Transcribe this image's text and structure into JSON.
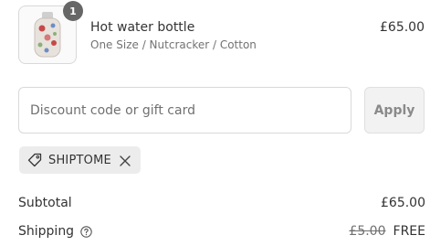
{
  "line_item": {
    "quantity": "1",
    "title": "Hot water bottle",
    "variant": "One Size / Nutcracker / Cotton",
    "price": "£65.00",
    "image_icon": "hot-water-bottle-icon"
  },
  "discount": {
    "placeholder": "Discount code or gift card",
    "value": "",
    "apply_label": "Apply"
  },
  "applied_code": {
    "code": "SHIPTOME",
    "tag_icon": "tag-icon",
    "remove_icon": "close-icon"
  },
  "summary": {
    "subtotal_label": "Subtotal",
    "subtotal_value": "£65.00",
    "shipping_label": "Shipping",
    "shipping_original": "£5.00",
    "shipping_value": "FREE"
  },
  "colors": {
    "badge": "#666666",
    "border": "#d9d9d9",
    "chip_bg": "#ececec"
  }
}
